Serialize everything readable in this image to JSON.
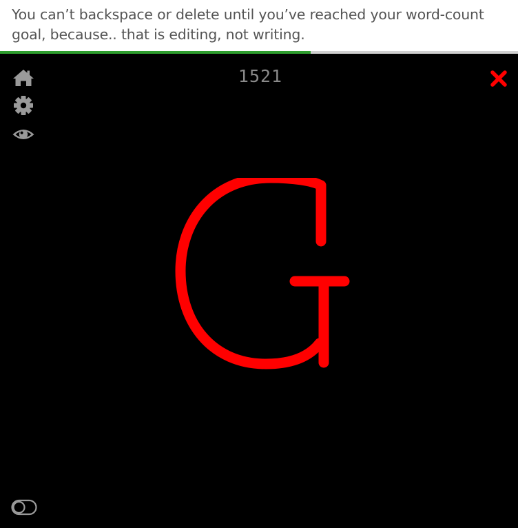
{
  "banner": {
    "message": "You can’t backspace or delete until you’ve reached your word-count goal, because.. that is editing, not writing."
  },
  "progress": {
    "fraction": 0.6,
    "color": "#2e9e2e"
  },
  "toolbar": {
    "icons": [
      "home-icon",
      "gear-icon",
      "eye-icon"
    ]
  },
  "editor": {
    "word_count": "1521",
    "current_letter": "G",
    "letter_color": "#ff0000",
    "close_icon": "close-icon",
    "close_color": "#ff0000"
  },
  "footer": {
    "toggle_icon": "toggle-icon"
  }
}
